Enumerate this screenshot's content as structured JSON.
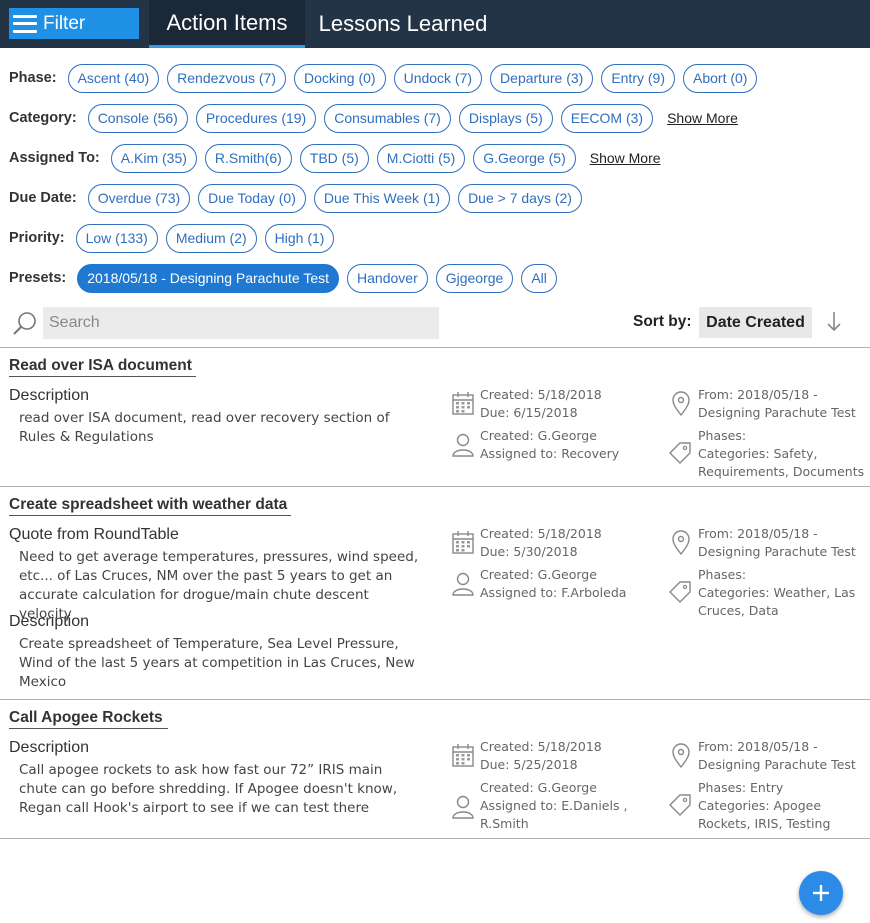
{
  "nav": {
    "filter_label": "Filter",
    "tabs": [
      {
        "label": "Action Items",
        "active": true
      },
      {
        "label": "Lessons Learned",
        "active": false
      }
    ]
  },
  "filters": {
    "phase": {
      "label": "Phase:",
      "chips": [
        "Ascent (40)",
        "Rendezvous (7)",
        "Docking (0)",
        "Undock (7)",
        "Departure (3)",
        "Entry (9)",
        "Abort (0)"
      ]
    },
    "category": {
      "label": "Category:",
      "chips": [
        "Console (56)",
        "Procedures (19)",
        "Consumables (7)",
        "Displays (5)",
        "EECOM (3)"
      ],
      "show_more": "Show More"
    },
    "assigned": {
      "label": "Assigned To:",
      "chips": [
        "A.Kim (35)",
        "R.Smith(6)",
        "TBD (5)",
        "M.Ciotti (5)",
        "G.George (5)"
      ],
      "show_more": "Show More"
    },
    "due": {
      "label": "Due Date:",
      "chips": [
        "Overdue (73)",
        "Due Today (0)",
        "Due This Week (1)",
        "Due > 7 days (2)"
      ]
    },
    "priority": {
      "label": "Priority:",
      "chips": [
        "Low (133)",
        "Medium (2)",
        "High (1)"
      ]
    },
    "presets": {
      "label": "Presets:",
      "chips": [
        "2018/05/18 - Designing Parachute Test",
        "Handover",
        "Gjgeorge",
        "All"
      ],
      "active_index": 0
    }
  },
  "search": {
    "placeholder": "Search"
  },
  "sort": {
    "label": "Sort by:",
    "value": "Date Created"
  },
  "items": [
    {
      "title": "Read over ISA document",
      "sections": [
        {
          "heading": "Description",
          "body": "read over ISA document, read over recovery section of Rules & Regulations"
        }
      ],
      "created_date": "Created: 5/18/2018",
      "due_date": "Due: 6/15/2018",
      "created_by": "Created: G.George",
      "assigned_to": "Assigned to: Recovery",
      "from": "From: 2018/05/18 - Designing Parachute Test",
      "phases": "Phases:",
      "categories": "Categories: Safety, Requirements, Documents"
    },
    {
      "title": "Create spreadsheet with weather data",
      "sections": [
        {
          "heading": "Quote from RoundTable",
          "body": "Need to get average temperatures, pressures, wind speed, etc... of Las Cruces, NM over the past 5 years to get an accurate calculation for drogue/main chute descent velocity"
        },
        {
          "heading": "Description",
          "body": "Create spreadsheet of Temperature, Sea Level Pressure, Wind of the last 5 years at competition in Las Cruces, New Mexico"
        }
      ],
      "created_date": "Created: 5/18/2018",
      "due_date": "Due: 5/30/2018",
      "created_by": "Created: G.George",
      "assigned_to": "Assigned to: F.Arboleda",
      "from": "From: 2018/05/18 - Designing Parachute Test",
      "phases": "Phases:",
      "categories": "Categories: Weather, Las Cruces, Data"
    },
    {
      "title": "Call Apogee Rockets",
      "sections": [
        {
          "heading": "Description",
          "body": "Call apogee rockets to ask how fast our 72” IRIS main chute can go before shredding. If Apogee doesn't know, Regan call Hook's airport to see if we can test there"
        }
      ],
      "created_date": "Created: 5/18/2018",
      "due_date": "Due: 5/25/2018",
      "created_by": "Created: G.George",
      "assigned_to": "Assigned to: E.Daniels , R.Smith",
      "from": "From: 2018/05/18 - Designing Parachute Test",
      "phases": "Phases: Entry",
      "categories": "Categories: Apogee Rockets, IRIS, Testing"
    }
  ],
  "fab": {
    "label": "+"
  }
}
